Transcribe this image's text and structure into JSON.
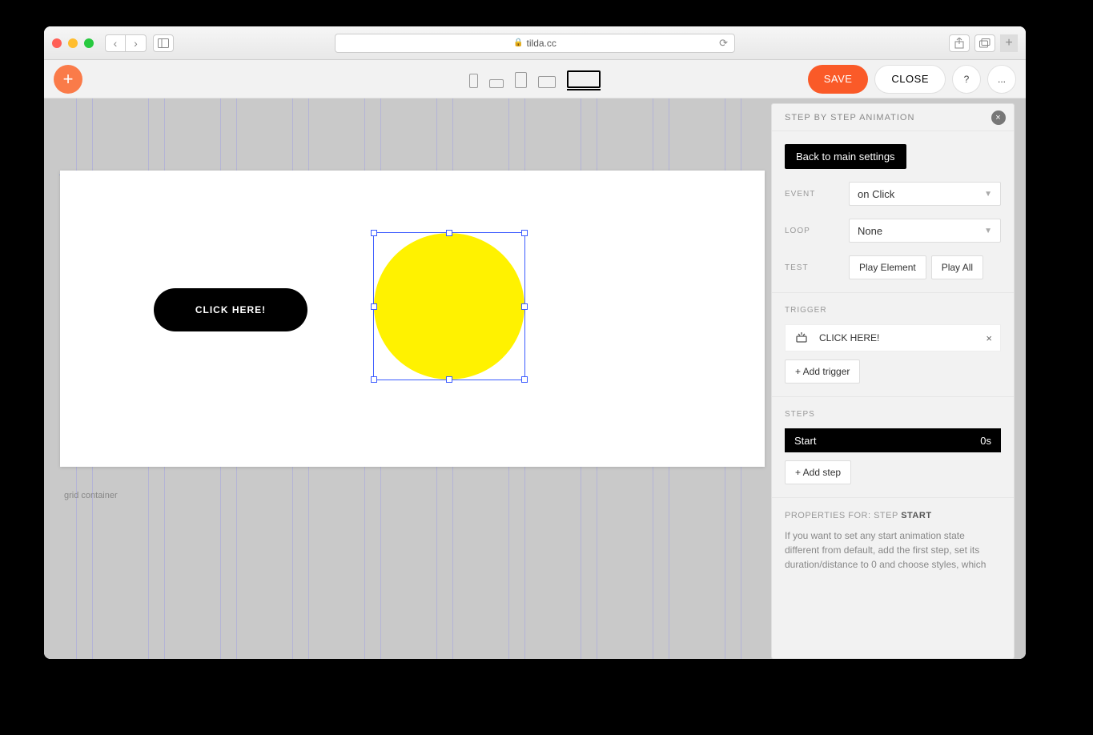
{
  "browser": {
    "url": "tilda.cc"
  },
  "toolbar": {
    "save": "SAVE",
    "close": "CLOSE",
    "help": "?",
    "more": "..."
  },
  "canvas": {
    "button_text": "CLICK HERE!",
    "footer_label": "grid container"
  },
  "panel": {
    "title": "STEP BY STEP ANIMATION",
    "back": "Back to main settings",
    "event_label": "EVENT",
    "event_value": "on Click",
    "loop_label": "LOOP",
    "loop_value": "None",
    "test_label": "TEST",
    "test_play_element": "Play Element",
    "test_play_all": "Play All",
    "trigger_label": "TRIGGER",
    "trigger_item": "CLICK HERE!",
    "add_trigger": "+ Add trigger",
    "steps_label": "STEPS",
    "step_start": "Start",
    "step_start_time": "0s",
    "add_step": "+ Add step",
    "props_prefix": "PROPERTIES FOR: STEP ",
    "props_step": "START",
    "help": "If you want to set any start animation state different from default, add the first step, set its duration/distance to 0 and choose styles, which"
  }
}
